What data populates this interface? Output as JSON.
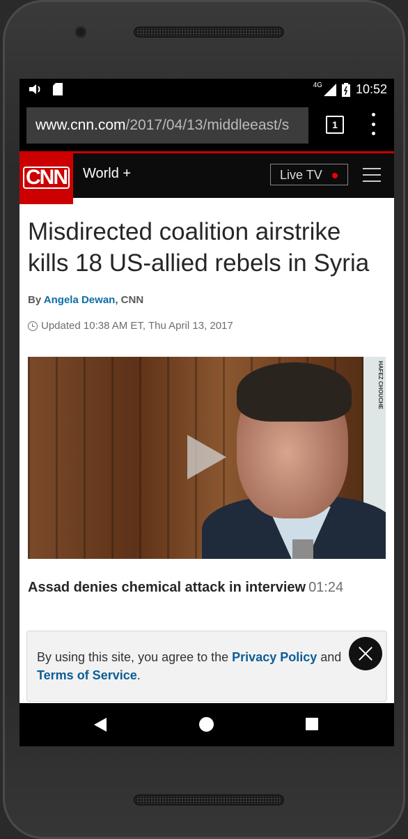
{
  "status_bar": {
    "network": "4G",
    "time": "10:52"
  },
  "browser": {
    "url_domain": "www.cnn.com",
    "url_path": "/2017/04/13/middleeast/s",
    "tab_count": "1"
  },
  "header": {
    "logo": "CNN",
    "section": "World +",
    "live_tv": "Live TV"
  },
  "article": {
    "headline": "Misdirected coalition airstrike kills 18 US-allied rebels in Syria",
    "byline_prefix": "By ",
    "author": "Angela Dewan",
    "byline_suffix": ", CNN",
    "updated": "Updated 10:38 AM ET, Thu April 13, 2017",
    "video": {
      "watermark": "HAFEZ CHOUCHE",
      "caption": "Assad denies chemical attack in interview",
      "duration": "01:24"
    }
  },
  "consent": {
    "text_1": "By using this site, you agree to the ",
    "privacy_link": "Privacy Policy",
    "text_2": " and ",
    "terms_link": "Terms of Service",
    "text_3": "."
  },
  "colors": {
    "brand_red": "#cc0000",
    "link_blue": "#0c6ea6"
  }
}
